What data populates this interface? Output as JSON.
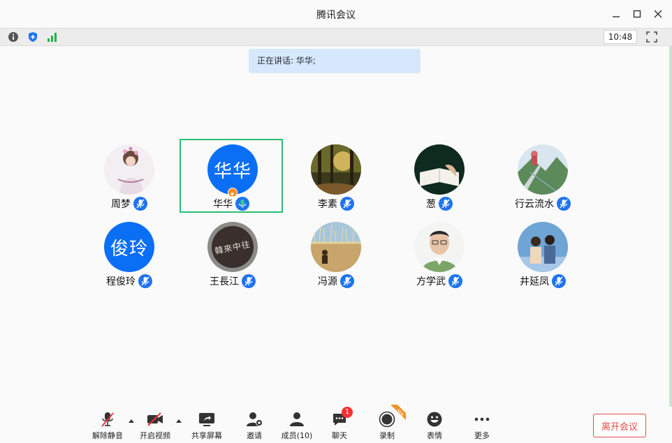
{
  "window": {
    "title": "腾讯会议"
  },
  "toolbar": {
    "time": "10:48"
  },
  "speaking": {
    "text": "正在讲话: 华华;"
  },
  "participants": [
    {
      "name": "周梦",
      "avatar": "photo-flowers-girl",
      "active": false,
      "host": false
    },
    {
      "name": "华华",
      "avatar": "text",
      "avatar_text": "华华",
      "avatar_color": "#0b6ff5",
      "active": true,
      "host": true
    },
    {
      "name": "李素",
      "avatar": "photo-forest-sunlight",
      "active": false,
      "host": false
    },
    {
      "name": "葱",
      "avatar": "photo-book-dark",
      "active": false,
      "host": false
    },
    {
      "name": "行云流水",
      "avatar": "photo-mountain-rail",
      "active": false,
      "host": false
    },
    {
      "name": "程俊玲",
      "avatar": "text",
      "avatar_text": "俊玲",
      "avatar_color": "#0b6ff5",
      "active": false,
      "host": false
    },
    {
      "name": "王長江",
      "avatar": "text-calligraphy",
      "avatar_text": "韓來中往",
      "avatar_color": "#3a2f2c",
      "active": false,
      "host": false
    },
    {
      "name": "冯源",
      "avatar": "photo-reeds-person",
      "active": false,
      "host": false
    },
    {
      "name": "方学武",
      "avatar": "photo-man-portrait",
      "active": false,
      "host": false
    },
    {
      "name": "井延凤",
      "avatar": "photo-couple-sky",
      "active": false,
      "host": false
    }
  ],
  "controls": {
    "unmute": "解除静音",
    "video": "开启视频",
    "share": "共享屏幕",
    "invite": "邀请",
    "members": "成员(10)",
    "chat": "聊天",
    "chat_badge": "1",
    "record": "录制",
    "record_tag": "NEW",
    "emoji": "表情",
    "more": "更多",
    "leave": "离开会议"
  },
  "colors": {
    "accent": "#1e74f0",
    "active_border": "#2ebd6f",
    "leave": "#e04a4a",
    "badge": "#f23232"
  }
}
